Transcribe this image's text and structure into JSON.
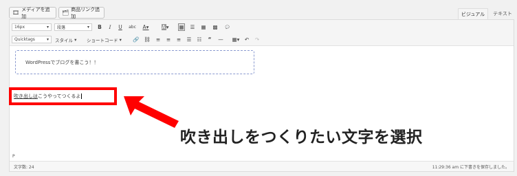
{
  "top_bar": {
    "add_media": "メディアを追加",
    "add_product_link": "商品リンク追加",
    "tab_visual": "ビジュアル",
    "tab_text": "テキスト"
  },
  "toolbar": {
    "font_size": "16px",
    "format": "段落",
    "quicktags": "Quicktags",
    "style": "スタイル",
    "shortcode": "ショートコード"
  },
  "content": {
    "box_text": "WordPressでブログを書こう！！",
    "line_underlined": "吹き出しは",
    "line_rest": "こうやってつくるよ"
  },
  "annotation": {
    "label": "吹き出しをつくりたい文字を選択",
    "color": "#ff0000"
  },
  "footer": {
    "path": "P",
    "word_count": "文字数: 24",
    "autosave": "11:29:36 am に下書きを保存しました。"
  }
}
